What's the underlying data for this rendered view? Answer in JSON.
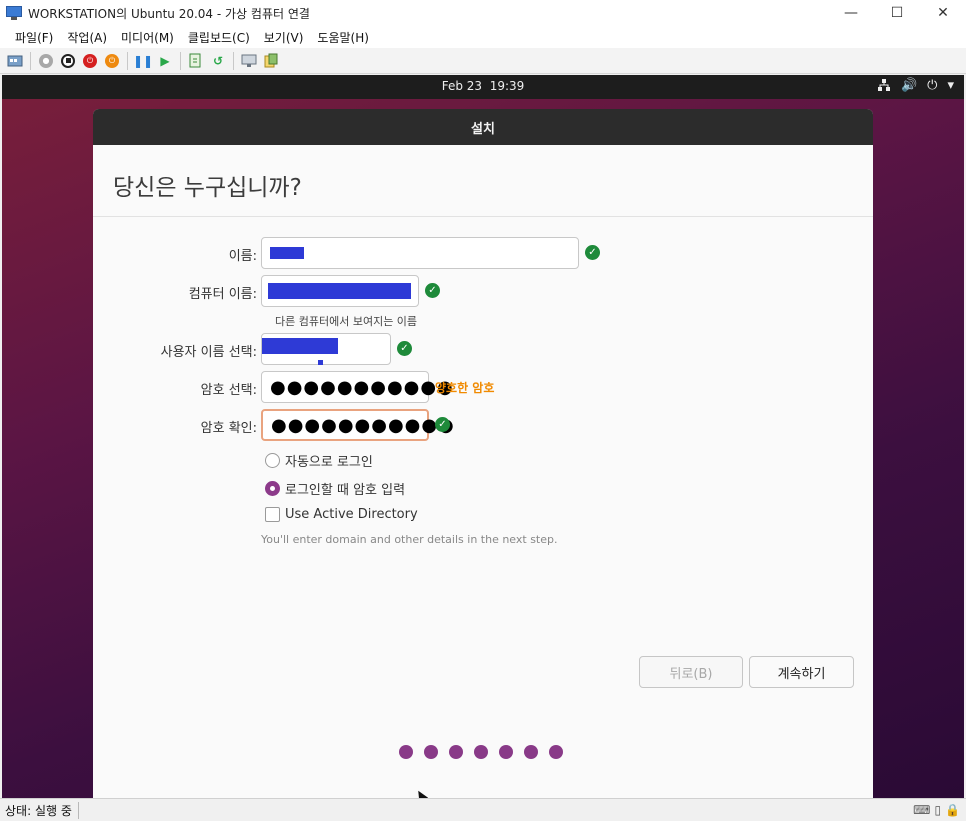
{
  "window": {
    "title": "WORKSTATION의 Ubuntu 20.04 - 가상 컴퓨터 연결",
    "minimize": "—",
    "maximize": "☐",
    "close": "✕"
  },
  "menu": [
    "파일(F)",
    "작업(A)",
    "미디어(M)",
    "클립보드(C)",
    "보기(V)",
    "도움말(H)"
  ],
  "toolbar": {
    "icons": [
      "ctrl-alt-del-icon",
      "start-icon",
      "turnoff-icon",
      "shutdown-icon",
      "save-icon",
      "pause-icon",
      "resume-icon",
      "checkpoint-icon",
      "revert-icon",
      "enhanced-session-icon",
      "share-icon"
    ]
  },
  "gnome": {
    "date": "Feb 23",
    "time": "19:39",
    "tray": [
      "network-icon",
      "volume-icon",
      "power-icon",
      "menu-arrow-icon"
    ]
  },
  "installer": {
    "header": "설치",
    "heading": "당신은 누구십니까?",
    "fields": {
      "name_label": "이름:",
      "computer_label": "컴퓨터 이름:",
      "computer_hint": "다른 컴퓨터에서 보여지는 이름",
      "username_label": "사용자 이름 선택:",
      "password_label": "암호 선택:",
      "password_value": "●●●●●●●●●●●",
      "password_strength": "양호한 암호",
      "confirm_label": "암호 확인:",
      "confirm_value": "●●●●●●●●●●●"
    },
    "options": {
      "auto_login": "자동으로 로그인",
      "require_password": "로그인할 때 암호 입력",
      "active_directory": "Use Active Directory",
      "ad_note": "You'll enter domain and other details in the next step."
    },
    "buttons": {
      "back": "뒤로(B)",
      "continue": "계속하기"
    },
    "progress_dots": 7,
    "accent_color": "#893a88"
  },
  "status": {
    "text": "상태: 실행 중"
  }
}
